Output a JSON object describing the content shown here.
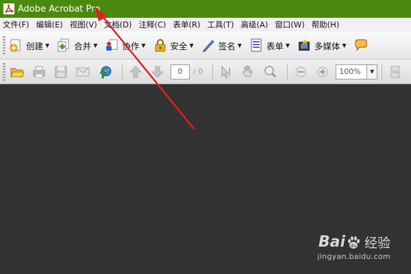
{
  "window": {
    "title": "Adobe Acrobat Pro",
    "titlebar_color": "#4a8a0e"
  },
  "menu": [
    "文件(F)",
    "编辑(E)",
    "视图(V)",
    "文档(D)",
    "注释(C)",
    "表单(R)",
    "工具(T)",
    "高级(A)",
    "窗口(W)",
    "帮助(H)"
  ],
  "toolbar_tasks": [
    {
      "label": "创建",
      "icon": "create-icon"
    },
    {
      "label": "合并",
      "icon": "combine-icon"
    },
    {
      "label": "协作",
      "icon": "collaborate-icon"
    },
    {
      "label": "安全",
      "icon": "lock-icon"
    },
    {
      "label": "签名",
      "icon": "pen-icon"
    },
    {
      "label": "表单",
      "icon": "form-icon"
    },
    {
      "label": "多媒体",
      "icon": "multimedia-icon"
    }
  ],
  "toolbar_nav": {
    "page_current": "0",
    "page_total": "/ 0",
    "zoom": "100%"
  },
  "annotation": {
    "arrow_color": "#e02020"
  },
  "watermark": {
    "brand_left": "Bai",
    "brand_right": "du",
    "brand_cn": "经验",
    "url": "jingyan.baidu.com"
  }
}
